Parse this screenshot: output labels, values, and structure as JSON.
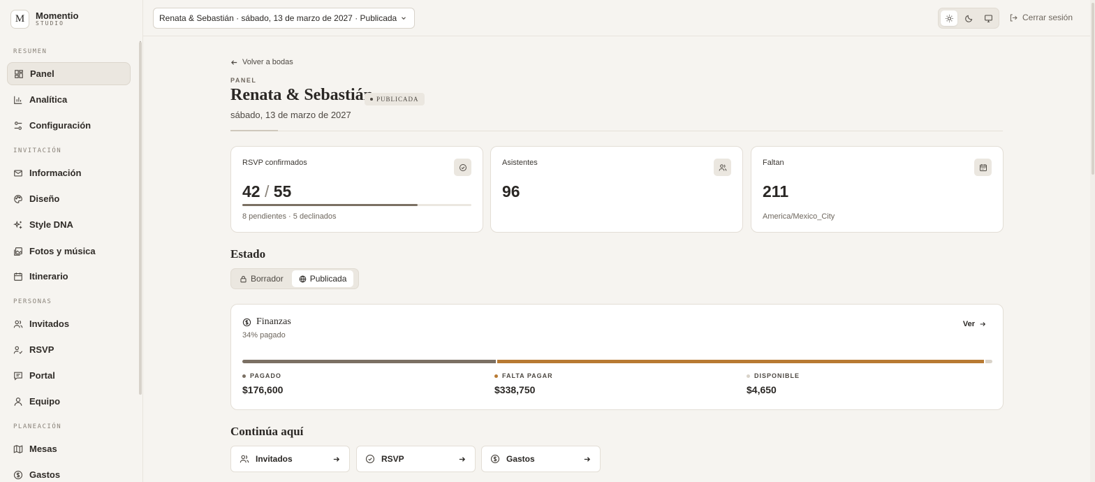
{
  "brand": {
    "name": "Momentio",
    "sub": "STUDIO",
    "logo_glyph": "M"
  },
  "sidebar": {
    "sections": [
      {
        "label": "RESUMEN",
        "items": [
          {
            "label": "Panel",
            "icon": "layout-dashboard-icon",
            "active": true
          },
          {
            "label": "Analítica",
            "icon": "bar-chart-icon"
          },
          {
            "label": "Configuración",
            "icon": "sliders-icon"
          }
        ]
      },
      {
        "label": "INVITACIÓN",
        "items": [
          {
            "label": "Información",
            "icon": "mail-icon"
          },
          {
            "label": "Diseño",
            "icon": "palette-icon"
          },
          {
            "label": "Style DNA",
            "icon": "sparkles-icon"
          },
          {
            "label": "Fotos y música",
            "icon": "images-icon"
          },
          {
            "label": "Itinerario",
            "icon": "calendar-icon"
          }
        ]
      },
      {
        "label": "PERSONAS",
        "items": [
          {
            "label": "Invitados",
            "icon": "users-icon"
          },
          {
            "label": "RSVP",
            "icon": "user-check-icon"
          },
          {
            "label": "Portal",
            "icon": "message-square-icon"
          },
          {
            "label": "Equipo",
            "icon": "user-icon"
          }
        ]
      },
      {
        "label": "PLANEACIÓN",
        "items": [
          {
            "label": "Mesas",
            "icon": "map-icon"
          },
          {
            "label": "Gastos",
            "icon": "dollar-circle-icon"
          }
        ]
      }
    ]
  },
  "topbar": {
    "wedding_select": "Renata & Sebastián · sábado, 13 de marzo de 2027 · Publicada",
    "theme_options": [
      "light",
      "dark",
      "system"
    ],
    "theme_selected": "light",
    "logout_label": "Cerrar sesión"
  },
  "page": {
    "back_label": "Volver a bodas",
    "eyebrow": "PANEL",
    "title": "Renata & Sebastián",
    "status_badge": "PUBLICADA",
    "date": "sábado, 13 de marzo de 2027"
  },
  "stats": {
    "rsvp": {
      "label": "RSVP confirmados",
      "confirmed": "42",
      "separator": "/",
      "total": "55",
      "progress": 0.764,
      "sub": "8 pendientes · 5 declinados",
      "icon": "check-circle-icon"
    },
    "attendees": {
      "label": "Asistentes",
      "value": "96",
      "icon": "users-icon"
    },
    "remaining": {
      "label": "Faltan",
      "value": "211",
      "sub": "America/Mexico_City",
      "icon": "calendar-icon"
    }
  },
  "estado": {
    "title": "Estado",
    "options": [
      {
        "label": "Borrador",
        "icon": "lock-icon",
        "active": false
      },
      {
        "label": "Publicada",
        "icon": "globe-icon",
        "active": true
      }
    ]
  },
  "finance": {
    "title": "Finanzas",
    "subtitle": "34% pagado",
    "link_label": "Ver",
    "colors": {
      "paid": "#7b7063",
      "due": "#b87a33",
      "available": "#d9d3c9"
    },
    "breakdown": [
      {
        "key": "paid",
        "label": "PAGADO",
        "value": "$176,600",
        "amount": 176600
      },
      {
        "key": "due",
        "label": "FALTA PAGAR",
        "value": "$338,750",
        "amount": 338750
      },
      {
        "key": "available",
        "label": "DISPONIBLE",
        "value": "$4,650",
        "amount": 4650
      }
    ]
  },
  "continue": {
    "title": "Continúa aquí",
    "actions": [
      {
        "label": "Invitados",
        "icon": "users-icon"
      },
      {
        "label": "RSVP",
        "icon": "check-circle-icon"
      },
      {
        "label": "Gastos",
        "icon": "dollar-circle-icon"
      }
    ]
  }
}
